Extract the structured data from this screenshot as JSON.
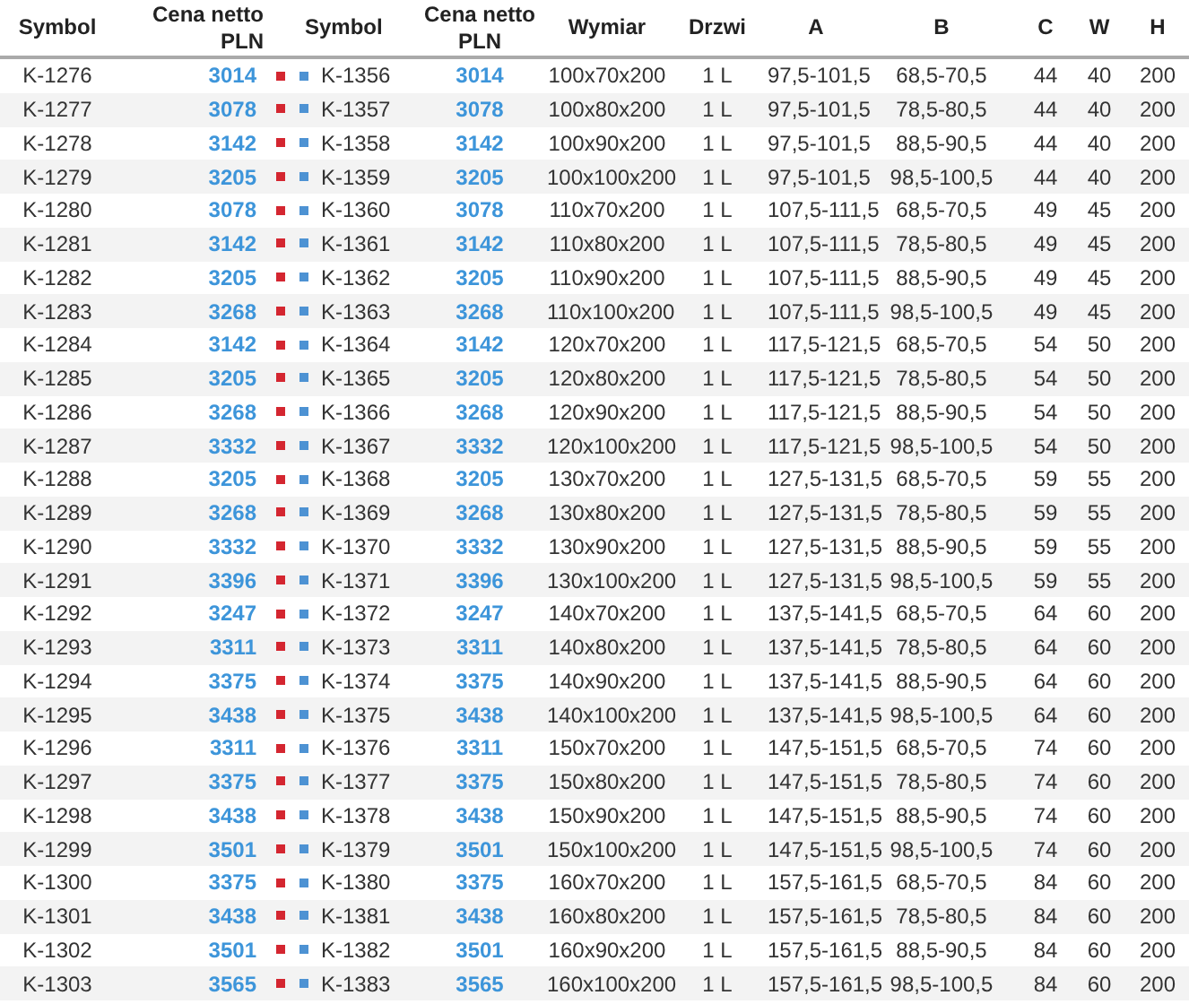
{
  "table": {
    "columns": [
      "Symbol",
      "Cena netto PLN",
      "Symbol",
      "Cena netto PLN",
      "Wymiar",
      "Drzwi",
      "A",
      "B",
      "C",
      "W",
      "H"
    ],
    "rows": [
      [
        "K-1276",
        "3014",
        "K-1356",
        "3014",
        "100x70x200",
        "1 L",
        "97,5-101,5",
        "68,5-70,5",
        "44",
        "40",
        "200"
      ],
      [
        "K-1277",
        "3078",
        "K-1357",
        "3078",
        "100x80x200",
        "1 L",
        "97,5-101,5",
        "78,5-80,5",
        "44",
        "40",
        "200"
      ],
      [
        "K-1278",
        "3142",
        "K-1358",
        "3142",
        "100x90x200",
        "1 L",
        "97,5-101,5",
        "88,5-90,5",
        "44",
        "40",
        "200"
      ],
      [
        "K-1279",
        "3205",
        "K-1359",
        "3205",
        "100x100x200",
        "1 L",
        "97,5-101,5",
        "98,5-100,5",
        "44",
        "40",
        "200"
      ],
      [
        "K-1280",
        "3078",
        "K-1360",
        "3078",
        "110x70x200",
        "1 L",
        "107,5-111,5",
        "68,5-70,5",
        "49",
        "45",
        "200"
      ],
      [
        "K-1281",
        "3142",
        "K-1361",
        "3142",
        "110x80x200",
        "1 L",
        "107,5-111,5",
        "78,5-80,5",
        "49",
        "45",
        "200"
      ],
      [
        "K-1282",
        "3205",
        "K-1362",
        "3205",
        "110x90x200",
        "1 L",
        "107,5-111,5",
        "88,5-90,5",
        "49",
        "45",
        "200"
      ],
      [
        "K-1283",
        "3268",
        "K-1363",
        "3268",
        "110x100x200",
        "1 L",
        "107,5-111,5",
        "98,5-100,5",
        "49",
        "45",
        "200"
      ],
      [
        "K-1284",
        "3142",
        "K-1364",
        "3142",
        "120x70x200",
        "1 L",
        "117,5-121,5",
        "68,5-70,5",
        "54",
        "50",
        "200"
      ],
      [
        "K-1285",
        "3205",
        "K-1365",
        "3205",
        "120x80x200",
        "1 L",
        "117,5-121,5",
        "78,5-80,5",
        "54",
        "50",
        "200"
      ],
      [
        "K-1286",
        "3268",
        "K-1366",
        "3268",
        "120x90x200",
        "1 L",
        "117,5-121,5",
        "88,5-90,5",
        "54",
        "50",
        "200"
      ],
      [
        "K-1287",
        "3332",
        "K-1367",
        "3332",
        "120x100x200",
        "1 L",
        "117,5-121,5",
        "98,5-100,5",
        "54",
        "50",
        "200"
      ],
      [
        "K-1288",
        "3205",
        "K-1368",
        "3205",
        "130x70x200",
        "1 L",
        "127,5-131,5",
        "68,5-70,5",
        "59",
        "55",
        "200"
      ],
      [
        "K-1289",
        "3268",
        "K-1369",
        "3268",
        "130x80x200",
        "1 L",
        "127,5-131,5",
        "78,5-80,5",
        "59",
        "55",
        "200"
      ],
      [
        "K-1290",
        "3332",
        "K-1370",
        "3332",
        "130x90x200",
        "1 L",
        "127,5-131,5",
        "88,5-90,5",
        "59",
        "55",
        "200"
      ],
      [
        "K-1291",
        "3396",
        "K-1371",
        "3396",
        "130x100x200",
        "1 L",
        "127,5-131,5",
        "98,5-100,5",
        "59",
        "55",
        "200"
      ],
      [
        "K-1292",
        "3247",
        "K-1372",
        "3247",
        "140x70x200",
        "1 L",
        "137,5-141,5",
        "68,5-70,5",
        "64",
        "60",
        "200"
      ],
      [
        "K-1293",
        "3311",
        "K-1373",
        "3311",
        "140x80x200",
        "1 L",
        "137,5-141,5",
        "78,5-80,5",
        "64",
        "60",
        "200"
      ],
      [
        "K-1294",
        "3375",
        "K-1374",
        "3375",
        "140x90x200",
        "1 L",
        "137,5-141,5",
        "88,5-90,5",
        "64",
        "60",
        "200"
      ],
      [
        "K-1295",
        "3438",
        "K-1375",
        "3438",
        "140x100x200",
        "1 L",
        "137,5-141,5",
        "98,5-100,5",
        "64",
        "60",
        "200"
      ],
      [
        "K-1296",
        "3311",
        "K-1376",
        "3311",
        "150x70x200",
        "1 L",
        "147,5-151,5",
        "68,5-70,5",
        "74",
        "60",
        "200"
      ],
      [
        "K-1297",
        "3375",
        "K-1377",
        "3375",
        "150x80x200",
        "1 L",
        "147,5-151,5",
        "78,5-80,5",
        "74",
        "60",
        "200"
      ],
      [
        "K-1298",
        "3438",
        "K-1378",
        "3438",
        "150x90x200",
        "1 L",
        "147,5-151,5",
        "88,5-90,5",
        "74",
        "60",
        "200"
      ],
      [
        "K-1299",
        "3501",
        "K-1379",
        "3501",
        "150x100x200",
        "1 L",
        "147,5-151,5",
        "98,5-100,5",
        "74",
        "60",
        "200"
      ],
      [
        "K-1300",
        "3375",
        "K-1380",
        "3375",
        "160x70x200",
        "1 L",
        "157,5-161,5",
        "68,5-70,5",
        "84",
        "60",
        "200"
      ],
      [
        "K-1301",
        "3438",
        "K-1381",
        "3438",
        "160x80x200",
        "1 L",
        "157,5-161,5",
        "78,5-80,5",
        "84",
        "60",
        "200"
      ],
      [
        "K-1302",
        "3501",
        "K-1382",
        "3501",
        "160x90x200",
        "1 L",
        "157,5-161,5",
        "88,5-90,5",
        "84",
        "60",
        "200"
      ],
      [
        "K-1303",
        "3565",
        "K-1383",
        "3565",
        "160x100x200",
        "1 L",
        "157,5-161,5",
        "98,5-100,5",
        "84",
        "60",
        "200"
      ]
    ]
  }
}
